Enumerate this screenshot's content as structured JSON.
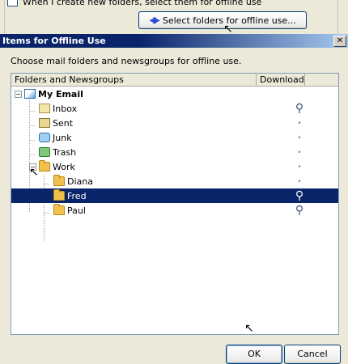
{
  "background_dialog": {
    "checkbox_label": "When I create new folders, select them for offline use",
    "select_button_label": "Select folders for offline use..."
  },
  "dialog": {
    "title": "Items for Offline Use",
    "close_label": "✕",
    "description": "Choose mail folders and newsgroups for offline use.",
    "columns": [
      "Folders and Newsgroups",
      "Download"
    ],
    "tree": [
      {
        "label": "My Email",
        "level": 0,
        "expand": "−",
        "icon": "email-account-icon",
        "download": "",
        "bold": true,
        "selected": false
      },
      {
        "label": "Inbox",
        "level": 1,
        "expand": "",
        "icon": "inbox-icon",
        "download": "pin",
        "bold": false,
        "selected": false
      },
      {
        "label": "Sent",
        "level": 1,
        "expand": "",
        "icon": "sent-icon",
        "download": "dot",
        "bold": false,
        "selected": false
      },
      {
        "label": "Junk",
        "level": 1,
        "expand": "",
        "icon": "junk-icon",
        "download": "dot",
        "bold": false,
        "selected": false
      },
      {
        "label": "Trash",
        "level": 1,
        "expand": "",
        "icon": "trash-icon",
        "download": "dot",
        "bold": false,
        "selected": false
      },
      {
        "label": "Work",
        "level": 1,
        "expand": "−",
        "icon": "folder-icon",
        "download": "dot",
        "bold": false,
        "selected": false
      },
      {
        "label": "Diana",
        "level": 2,
        "expand": "",
        "icon": "folder-icon",
        "download": "dot",
        "bold": false,
        "selected": false
      },
      {
        "label": "Fred",
        "level": 2,
        "expand": "",
        "icon": "folder-icon",
        "download": "pin",
        "bold": false,
        "selected": true
      },
      {
        "label": "Paul",
        "level": 2,
        "expand": "",
        "icon": "folder-icon",
        "download": "pin",
        "bold": false,
        "selected": false
      }
    ],
    "ok_label": "OK",
    "cancel_label": "Cancel"
  }
}
